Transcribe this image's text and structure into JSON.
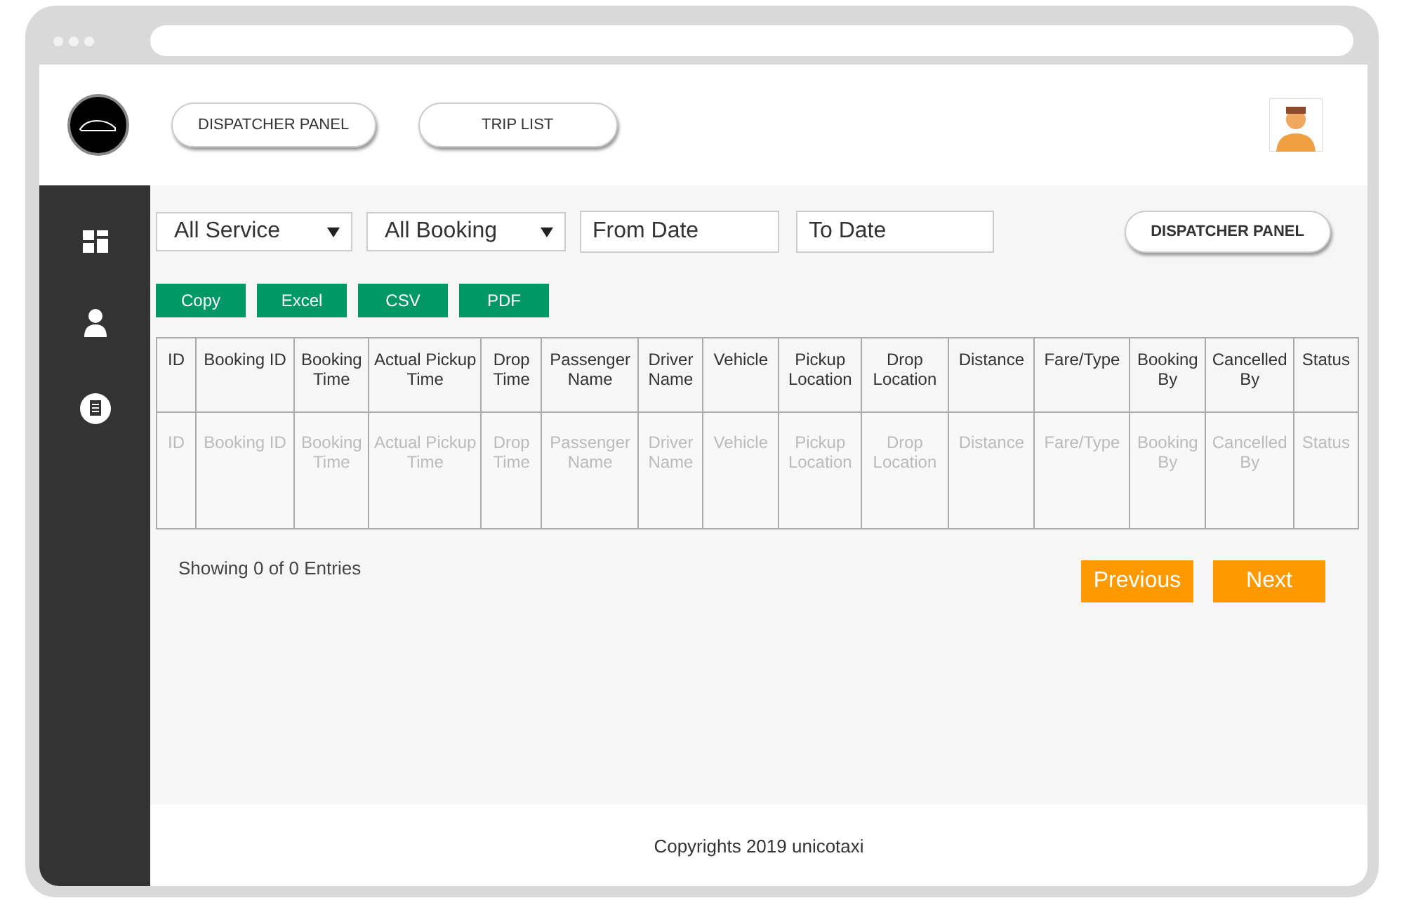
{
  "header": {
    "nav_buttons": [
      "DISPATCHER PANEL",
      "TRIP LIST"
    ]
  },
  "filters": {
    "service": {
      "value": "All Service"
    },
    "booking": {
      "value": "All Booking"
    },
    "from_date": {
      "placeholder": "From Date"
    },
    "to_date": {
      "placeholder": "To Date"
    },
    "panel_button": "DISPATCHER PANEL"
  },
  "export_buttons": [
    "Copy",
    "Excel",
    "CSV",
    "PDF"
  ],
  "table": {
    "columns": [
      "ID",
      "Booking ID",
      "Booking Time",
      "Actual Pickup Time",
      "Drop Time",
      "Passenger Name",
      "Driver Name",
      "Vehicle",
      "Pickup Location",
      "Drop Location",
      "Distance",
      "Fare/Type",
      "Booking By",
      "Cancelled By",
      "Status"
    ],
    "rows": [
      [
        "ID",
        "Booking ID",
        "Booking Time",
        "Actual Pickup Time",
        "Drop Time",
        "Passenger Name",
        "Driver Name",
        "Vehicle",
        "Pickup Location",
        "Drop Location",
        "Distance",
        "Fare/Type",
        "Booking By",
        "Cancelled By",
        "Status"
      ]
    ]
  },
  "entries_info": "Showing 0 of 0 Entries",
  "pagination": [
    "Previous",
    "Next"
  ],
  "footer": "Copyrights 2019 unicotaxi"
}
